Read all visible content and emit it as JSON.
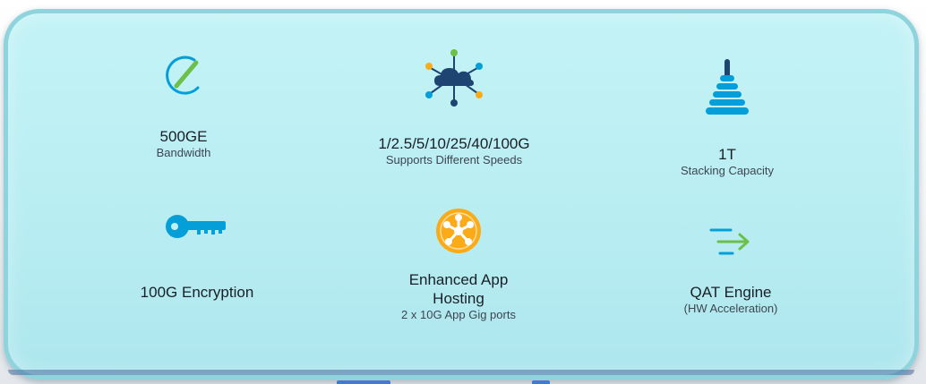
{
  "features": [
    {
      "id": "bandwidth",
      "title": "500GE",
      "subtitle": "Bandwidth",
      "icon": "speedometer-icon"
    },
    {
      "id": "speeds",
      "title": "1/2.5/5/10/25/40/100G",
      "subtitle": "Supports Different Speeds",
      "icon": "cloud-network-icon"
    },
    {
      "id": "stacking",
      "title": "1T",
      "subtitle": "Stacking Capacity",
      "icon": "stack-tower-icon"
    },
    {
      "id": "encryption",
      "title": "100G Encryption",
      "subtitle": "",
      "icon": "key-icon"
    },
    {
      "id": "app-hosting",
      "title": "Enhanced App Hosting",
      "title_line1": "Enhanced App",
      "title_line2": "Hosting",
      "subtitle": "2 x 10G App Gig ports",
      "icon": "app-hosting-icon"
    },
    {
      "id": "qat",
      "title": "QAT Engine",
      "subtitle": "(HW Acceleration)",
      "icon": "acceleration-arrow-icon"
    }
  ],
  "colors": {
    "panel_fill": "#bff0f5",
    "panel_border": "#8fd3dd",
    "cisco_blue": "#049fd9",
    "navy": "#1e4471",
    "green": "#6cc04a",
    "orange": "#fbab18",
    "text": "#1a1f26"
  }
}
